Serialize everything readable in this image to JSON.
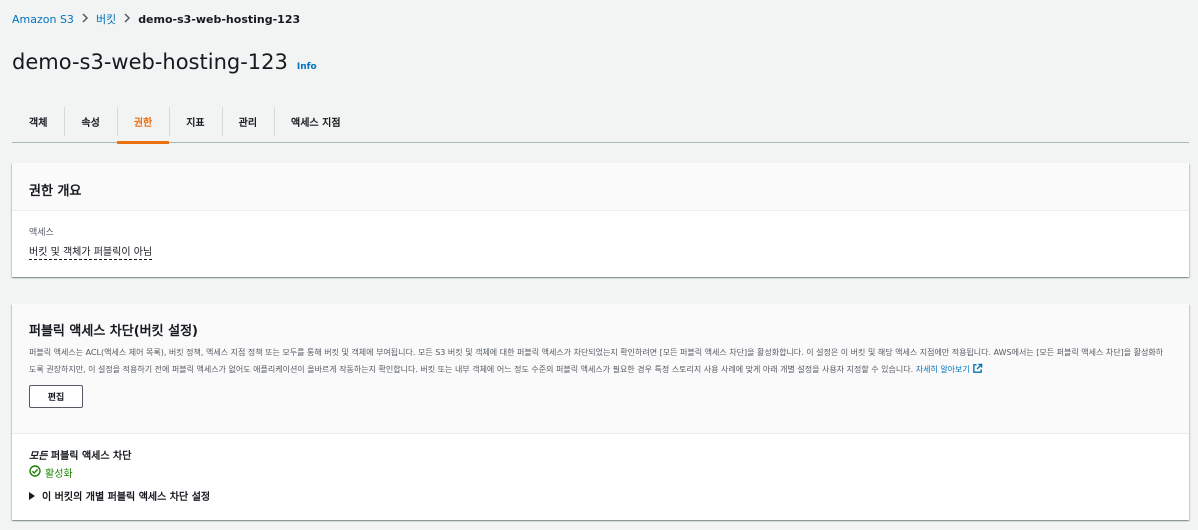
{
  "breadcrumb": {
    "items": [
      "Amazon S3",
      "버킷"
    ],
    "current": "demo-s3-web-hosting-123"
  },
  "page": {
    "title": "demo-s3-web-hosting-123",
    "info": "Info"
  },
  "tabs": [
    {
      "label": "객체",
      "active": false
    },
    {
      "label": "속성",
      "active": false
    },
    {
      "label": "권한",
      "active": true
    },
    {
      "label": "지표",
      "active": false
    },
    {
      "label": "관리",
      "active": false
    },
    {
      "label": "액세스 지점",
      "active": false
    }
  ],
  "overview": {
    "title": "권한 개요",
    "access_label": "액세스",
    "access_value": "버킷 및 객체가 퍼블릭이 아님"
  },
  "block_public": {
    "title": "퍼블릭 액세스 차단(버킷 설정)",
    "description": "퍼블릭 액세스는 ACL(액세스 제어 목록), 버킷 정책, 액세스 지점 정책 또는 모두를 통해 버킷 및 객체에 부여됩니다. 모든 S3 버킷 및 객체에 대한 퍼블릭 액세스가 차단되었는지 확인하려면 [모든 퍼블릭 액세스 차단]을 활성화합니다. 이 설정은 이 버킷 및 해당 액세스 지점에만 적용됩니다. AWS에서는 [모든 퍼블릭 액세스 차단]을 활성화하도록 권장하지만, 이 설정을 적용하기 전에 퍼블릭 액세스가 없어도 애플리케이션이 올바르게 작동하는지 확인합니다. 버킷 또는 내부 객체에 어느 정도 수준의 퍼블릭 액세스가 필요한 경우 특정 스토리지 사용 사례에 맞게 아래 개별 설정을 사용자 지정할 수 있습니다.",
    "learn_more": "자세히 알아보기",
    "edit_button": "편집",
    "setting_label_italic": "모든",
    "setting_label_rest": " 퍼블릭 액세스 차단",
    "status": "활성화",
    "status_color": "#1d8102",
    "expander": "이 버킷의 개별 퍼블릭 액세스 차단 설정"
  },
  "colors": {
    "accent": "#ec7211",
    "link": "#0073bb"
  }
}
